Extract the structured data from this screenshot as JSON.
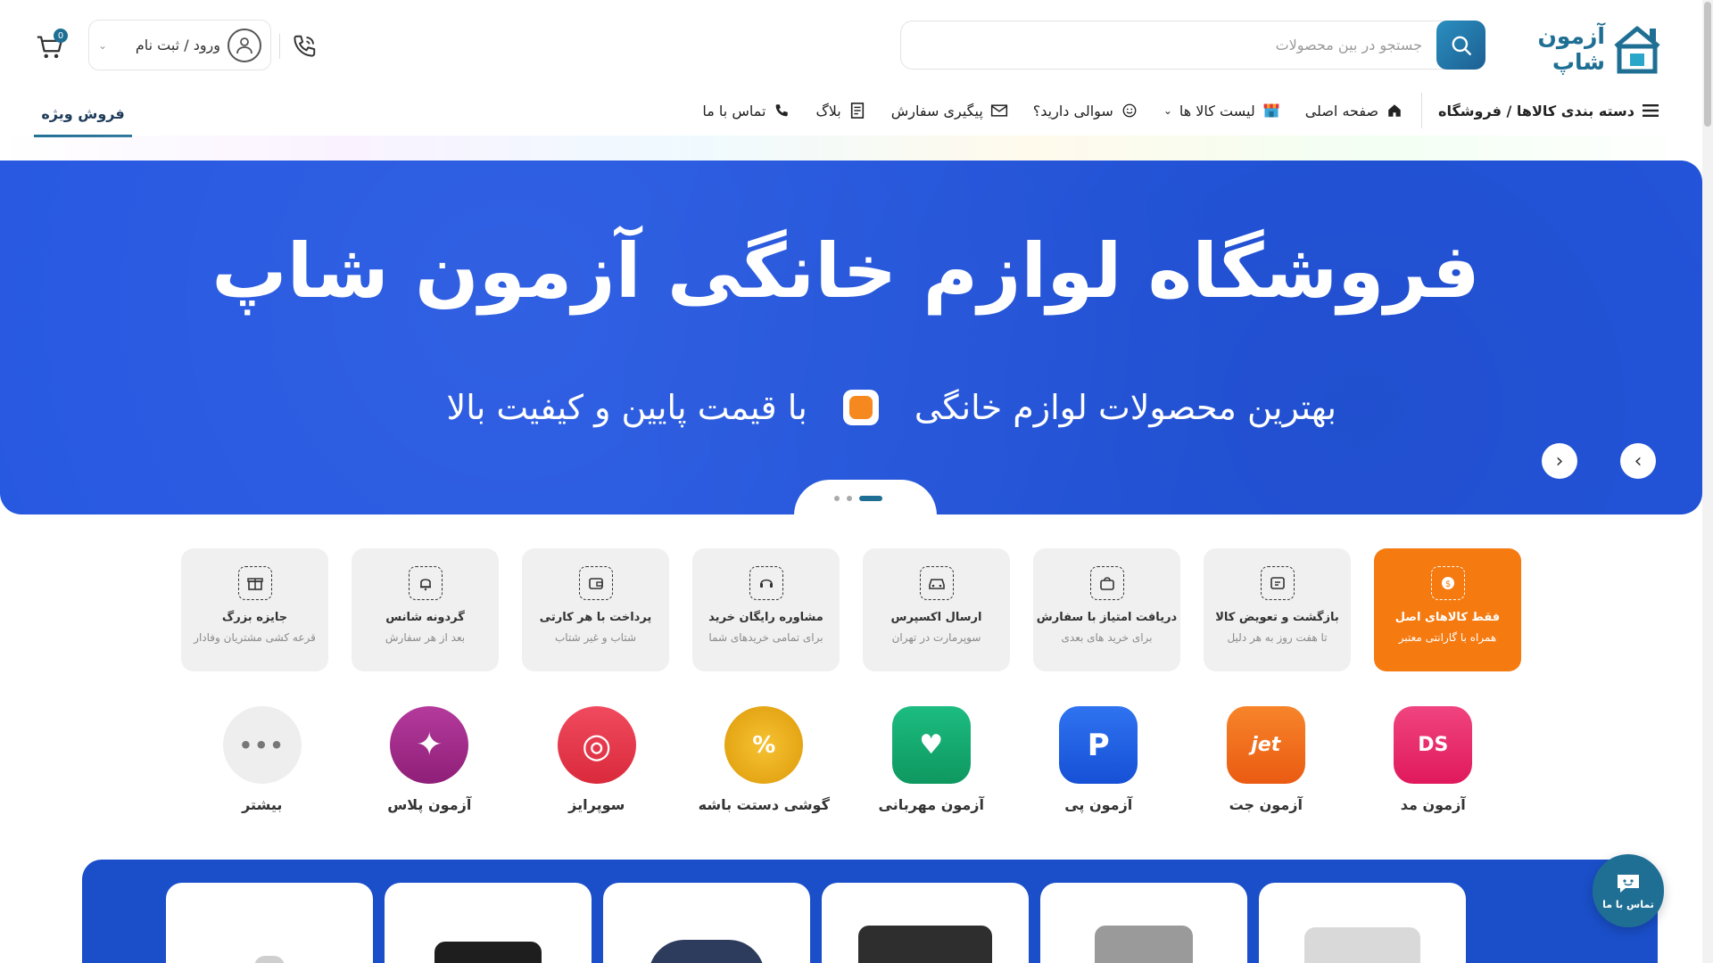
{
  "header": {
    "logo_text": "آزمون شاپ",
    "search_placeholder": "جستجو در بین محصولات",
    "login_label": "ورود / ثبت نام",
    "cart_count": "0"
  },
  "nav": {
    "categories": "دسته بندی کالاها / فروشگاه",
    "home": "صفحه اصلی",
    "products_list": "لیست کالا ها",
    "faq": "سوالی دارید؟",
    "order_tracking": "پیگیری سفارش",
    "blog": "بلاگ",
    "contact": "تماس با ما",
    "special_sale": "فروش ویژه"
  },
  "hero": {
    "title": "فروشگاه لوازم خانگی آزمون شاپ",
    "subtitle_right": "بهترین محصولات لوازم خانگی",
    "subtitle_left": "با قیمت پایین و کیفیت بالا",
    "slide_count": 3,
    "active_slide": 1
  },
  "features": [
    {
      "title": "فقط کالاهای اصل",
      "subtitle": "همراه با گارانتی معتبر",
      "icon": "coin-icon",
      "active": true
    },
    {
      "title": "بازگشت و تعویض کالا",
      "subtitle": "تا هفت روز به هر دلیل",
      "icon": "return-icon",
      "active": false
    },
    {
      "title": "دریافت امتیاز با سفارش",
      "subtitle": "برای خرید های بعدی",
      "icon": "bag-icon",
      "active": false
    },
    {
      "title": "ارسال اکسپرس",
      "subtitle": "سوپرمارت در تهران",
      "icon": "car-icon",
      "active": false
    },
    {
      "title": "مشاوره رایگان خرید",
      "subtitle": "برای تمامی خریدهای شما",
      "icon": "headset-icon",
      "active": false
    },
    {
      "title": "پرداخت با هر کارتی",
      "subtitle": "شتاب و غیر شتاب",
      "icon": "wallet-icon",
      "active": false
    },
    {
      "title": "گردونه شانس",
      "subtitle": "بعد از هر سفارش",
      "icon": "bell-icon",
      "active": false
    },
    {
      "title": "جایزه بزرگ",
      "subtitle": "قرعه کشی مشتریان وفادار",
      "icon": "gift-icon",
      "active": false
    }
  ],
  "services": [
    {
      "label": "آزمون مد",
      "icon_text": "DS",
      "color": "#e8246b"
    },
    {
      "label": "آزمون جت",
      "icon_text": "jet",
      "color": "#f26a1b"
    },
    {
      "label": "آزمون پی",
      "icon_text": "P",
      "color": "#1d5fe3"
    },
    {
      "label": "آزمون مهربانی",
      "icon_text": "♥",
      "color": "#12a36a"
    },
    {
      "label": "گوشی دستت باشه",
      "icon_text": "%",
      "color": "#e3a10f"
    },
    {
      "label": "سوپرایز",
      "icon_text": "◎",
      "color": "#e8344a"
    },
    {
      "label": "آزمون پلاس",
      "icon_text": "✦",
      "color": "#a12a8a"
    },
    {
      "label": "بیشتر",
      "icon_text": "•••",
      "color": "#eeeeee"
    }
  ],
  "chat": {
    "label": "تماس با ما"
  },
  "colors": {
    "brand": "#1f6f94",
    "hero": "#2456e0",
    "accent": "#f57a10"
  }
}
